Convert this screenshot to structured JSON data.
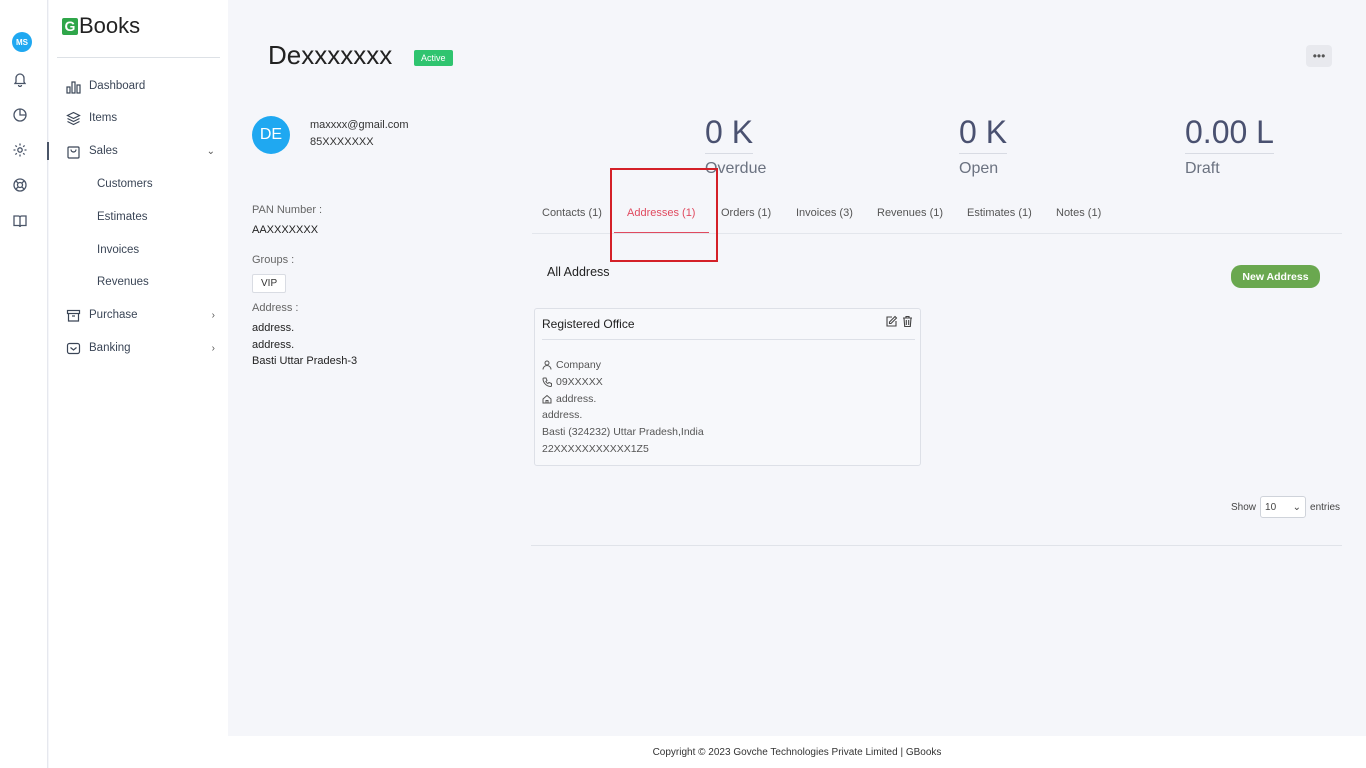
{
  "rail": {
    "avatar_initials": "MS"
  },
  "brand": {
    "logo_letter": "G",
    "logo_text": "Books"
  },
  "nav": {
    "dashboard": "Dashboard",
    "items": "Items",
    "sales": "Sales",
    "customers": "Customers",
    "estimates": "Estimates",
    "invoices": "Invoices",
    "revenues": "Revenues",
    "purchase": "Purchase",
    "banking": "Banking"
  },
  "customer": {
    "name": "Dexxxxxxx",
    "status": "Active",
    "initials": "DE",
    "email": "maxxxx@gmail.com",
    "phone": "85XXXXXXX",
    "pan_label": "PAN Number :",
    "pan_value": "AAXXXXXXX",
    "groups_label": "Groups :",
    "group_value": "VIP",
    "address_label": "Address :",
    "address_line1": "address.",
    "address_line2": "address.",
    "address_line3": "Basti Uttar Pradesh-3"
  },
  "stats": {
    "overdue_value": "0 K",
    "overdue_label": "Overdue",
    "open_value": "0 K",
    "open_label": "Open",
    "draft_value": "0.00 L",
    "draft_label": "Draft"
  },
  "tabs": {
    "contacts": "Contacts (1)",
    "addresses": "Addresses (1)",
    "orders": "Orders (1)",
    "invoices": "Invoices (3)",
    "revenues": "Revenues (1)",
    "estimates": "Estimates (1)",
    "notes": "Notes (1)"
  },
  "addresses": {
    "heading": "All Address",
    "new_button": "New Address",
    "card": {
      "title": "Registered Office",
      "type": "Company",
      "phone": "09XXXXX",
      "line1": "address.",
      "line2": "address.",
      "city_line": "Basti (324232) Uttar Pradesh,India",
      "gst": "22XXXXXXXXXXX1Z5"
    }
  },
  "table": {
    "show_label": "Show",
    "page_size": "10",
    "entries_label": "entries"
  },
  "footer": {
    "text": "Copyright © 2023 Govche Technologies Private Limited | GBooks"
  },
  "colors": {
    "accent_red": "#e04a5f",
    "active_green": "#2fc46f",
    "button_green": "#6aa84f",
    "avatar_blue": "#1fa8f1"
  }
}
